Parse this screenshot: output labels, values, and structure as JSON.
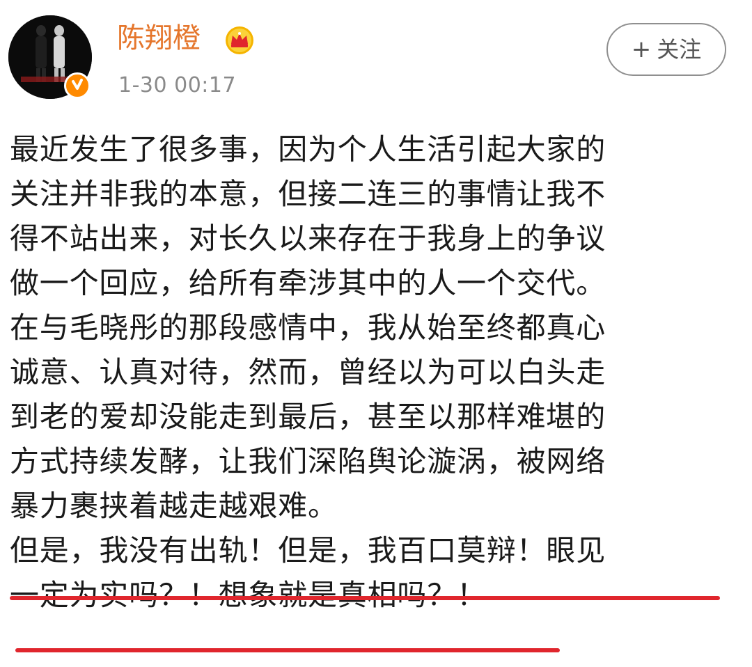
{
  "user": {
    "name": "陈翔橙",
    "timestamp": "1-30 00:17",
    "verified_badge_color": "#ff8a00",
    "crown_icon": "vip-crown-icon"
  },
  "follow_button": {
    "plus": "+",
    "label": "关注"
  },
  "post": {
    "lines": [
      "最近发生了很多事，因为个人生活引起大家的",
      "关注并非我的本意，但接二连三的事情让我不",
      "得不站出来，对长久以来存在于我身上的争议",
      "做一个回应，给所有牵涉其中的人一个交代。",
      "在与毛晓彤的那段感情中，我从始至终都真心",
      "诚意、认真对待，然而，曾经以为可以白头走",
      "到老的爱却没能走到最后，甚至以那样难堪的",
      "方式持续发酵，让我们深陷舆论漩涡，被网络",
      "暴力裹挟着越走越艰难。",
      "但是，我没有出轨！但是，我百口莫辩！眼见",
      "一定为实吗？！想象就是真相吗？！"
    ]
  },
  "colors": {
    "username": "#e5762c",
    "timestamp": "#8a8a8a",
    "underline": "#e0262d",
    "text": "#1a1a1a"
  }
}
